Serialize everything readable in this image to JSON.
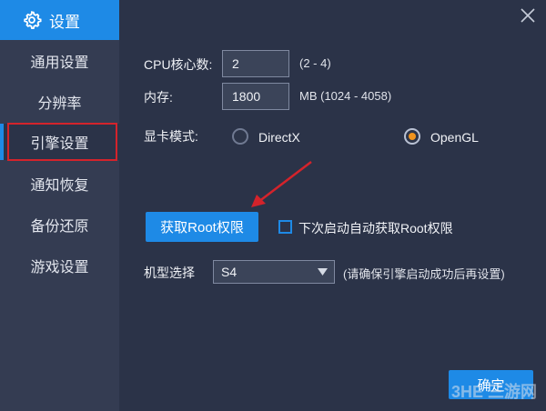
{
  "window": {
    "title": "设置",
    "close_icon": "close-icon"
  },
  "sidebar": {
    "items": [
      {
        "label": "通用设置",
        "active": false
      },
      {
        "label": "分辨率",
        "active": false
      },
      {
        "label": "引擎设置",
        "active": true
      },
      {
        "label": "通知恢复",
        "active": false
      },
      {
        "label": "备份还原",
        "active": false
      },
      {
        "label": "游戏设置",
        "active": false
      }
    ]
  },
  "engine": {
    "cpu_label": "CPU核心数:",
    "cpu_value": "2",
    "cpu_range": "(2 - 4)",
    "memory_label": "内存:",
    "memory_value": "1800",
    "memory_range": "MB  (1024 - 4058)",
    "gpu_label": "显卡模式:",
    "gpu_options": [
      {
        "label": "DirectX",
        "checked": false
      },
      {
        "label": "OpenGL",
        "checked": true
      }
    ],
    "root_button": "获取Root权限",
    "auto_root_label": "下次启动自动获取Root权限",
    "auto_root_checked": false,
    "model_label": "机型选择",
    "model_value": "S4",
    "model_note": "(请确保引擎启动成功后再设置)"
  },
  "footer": {
    "confirm_label": "确定"
  },
  "watermark": "3HE 三游网",
  "colors": {
    "accent": "#1e8ae6",
    "highlight": "#d4232b",
    "radio_checked": "#f0941e"
  }
}
